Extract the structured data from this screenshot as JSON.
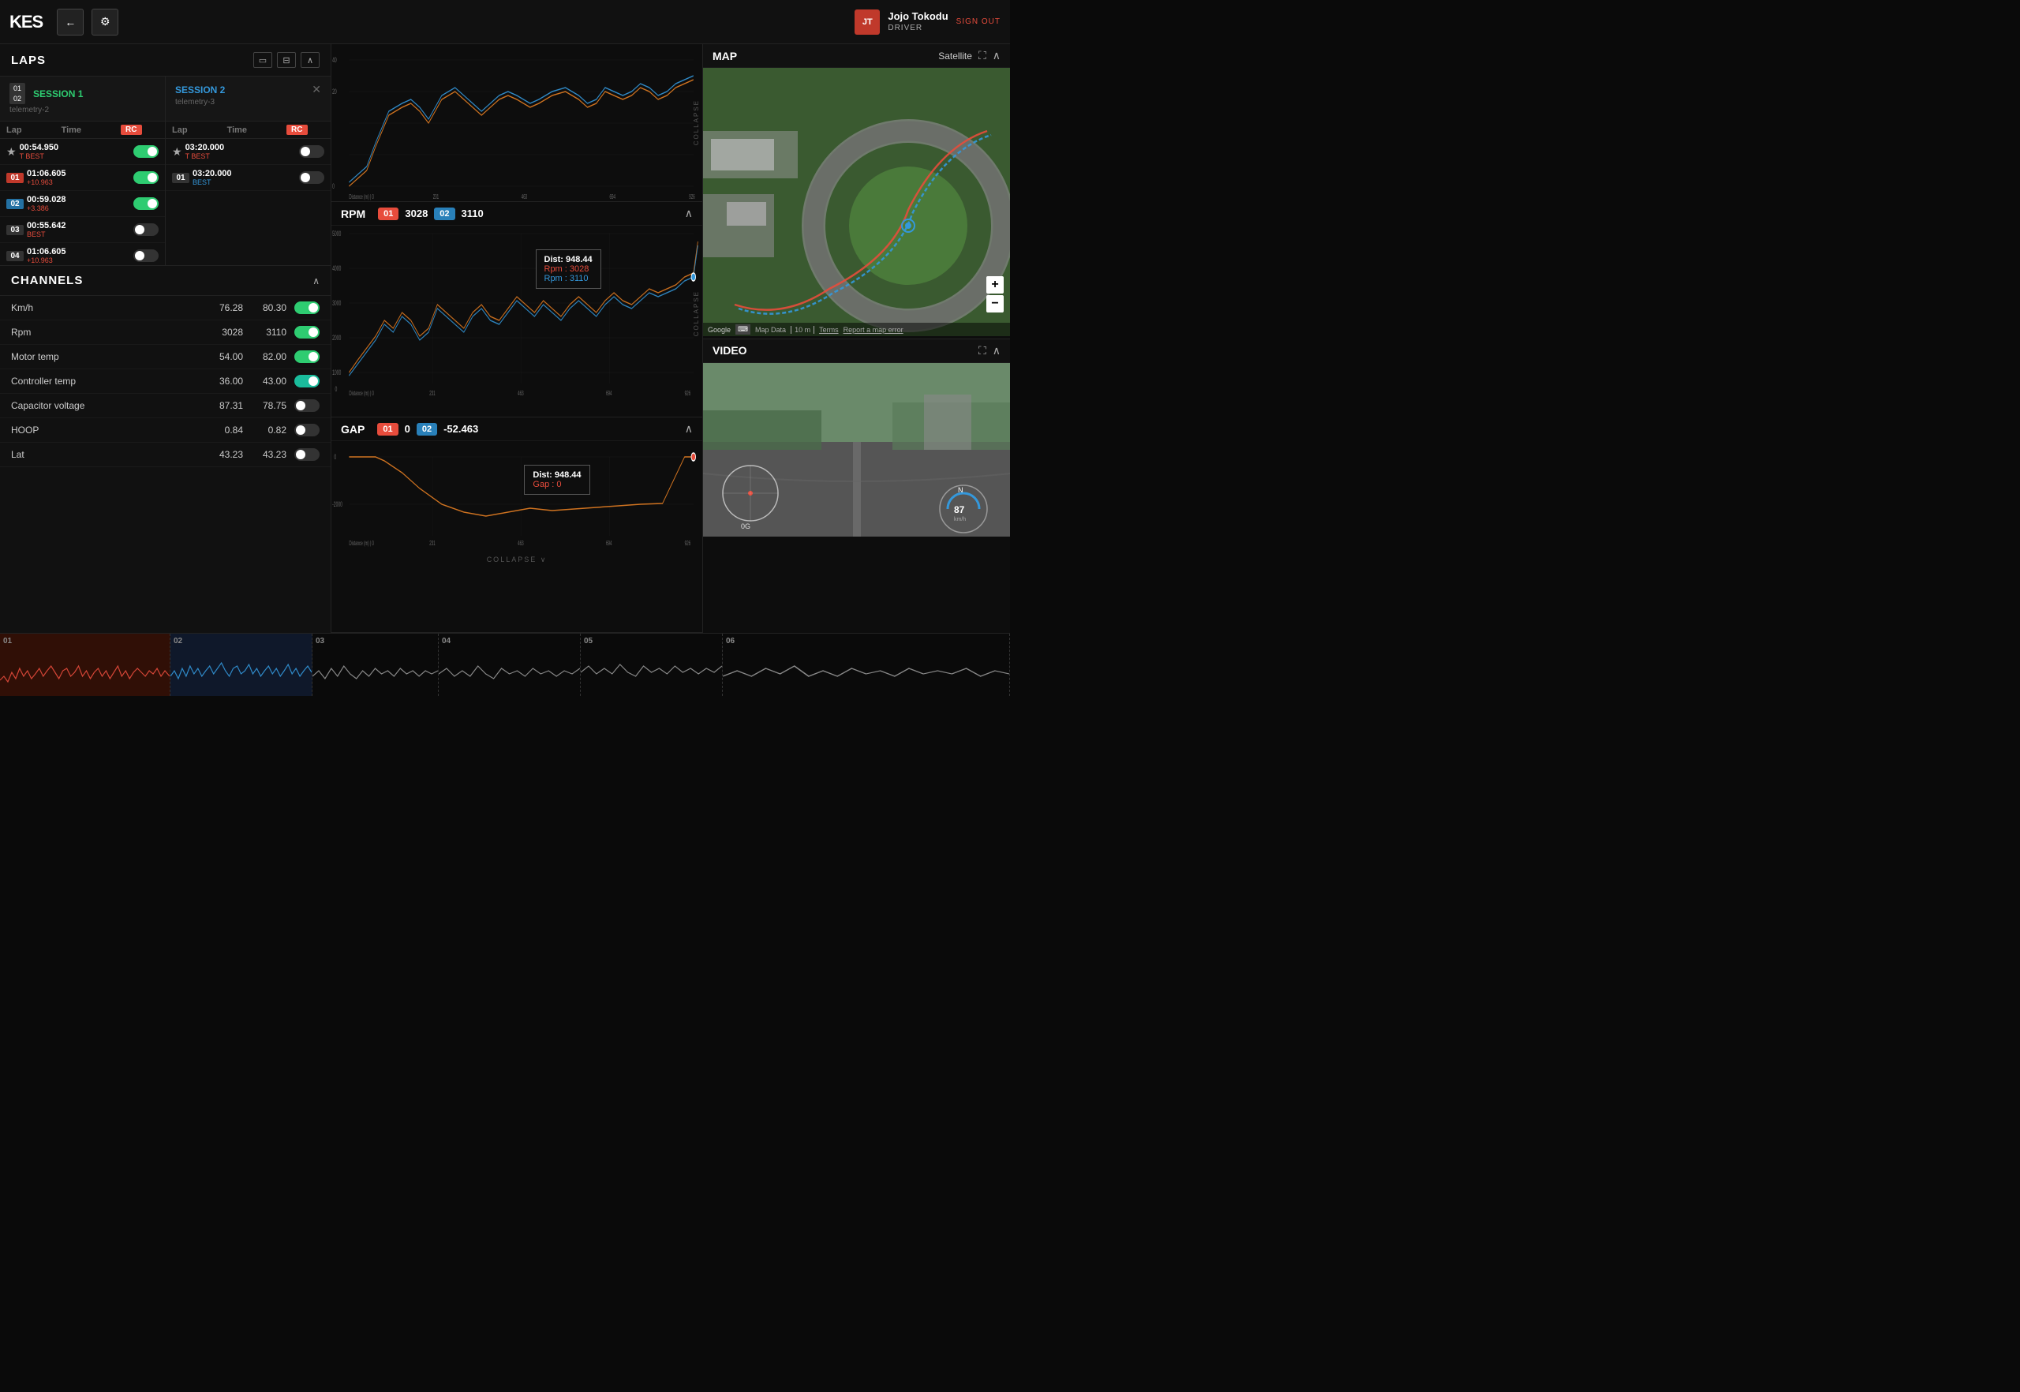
{
  "header": {
    "logo": "KES",
    "back_btn": "←",
    "settings_btn": "⚙",
    "user_initials": "JT",
    "user_name": "Jojo Tokodu",
    "user_role": "DRIVER",
    "sign_out": "SIGN OUT"
  },
  "laps": {
    "title": "LAPS",
    "sessions": [
      {
        "nums": "01\n02",
        "name": "SESSION 1",
        "sub": "telemetry-2",
        "color": "green"
      },
      {
        "name": "SESSION 2",
        "sub": "telemetry-3",
        "color": "blue",
        "has_close": true
      }
    ],
    "col_lap1": "Lap",
    "col_time1": "Time",
    "rc1": "RC",
    "col_lap2": "Lap",
    "col_time2": "Time",
    "rc2": "RC",
    "session1_laps": [
      {
        "num": "★",
        "is_star": true,
        "time": "00:54.950",
        "delta": "T BEST",
        "delta_class": "best",
        "toggle": "on"
      },
      {
        "num": "01",
        "is_star": false,
        "time": "01:06.605",
        "delta": "+10.963",
        "delta_class": "red",
        "toggle": "on",
        "badge_class": "red"
      },
      {
        "num": "02",
        "is_star": false,
        "time": "00:59.028",
        "delta": "+3.386",
        "delta_class": "red",
        "toggle": "on",
        "badge_class": "blue-bg"
      },
      {
        "num": "03",
        "is_star": false,
        "time": "00:55.642",
        "delta": "BEST",
        "delta_class": "best",
        "toggle": "off"
      },
      {
        "num": "04",
        "is_star": false,
        "time": "01:06.605",
        "delta": "+10.963",
        "delta_class": "red",
        "toggle": "off"
      }
    ],
    "session2_laps": [
      {
        "num": "★",
        "is_star": true,
        "time": "03:20.000",
        "delta": "T BEST",
        "delta_class": "best",
        "toggle": "off"
      },
      {
        "num": "01",
        "is_star": false,
        "time": "03:20.000",
        "delta": "BEST",
        "delta_class": "blue-c",
        "toggle": "off"
      }
    ]
  },
  "channels": {
    "title": "CHANNELS",
    "items": [
      {
        "name": "Km/h",
        "val1": "76.28",
        "val2": "80.30",
        "toggle": "on"
      },
      {
        "name": "Rpm",
        "val1": "3028",
        "val2": "3110",
        "toggle": "on"
      },
      {
        "name": "Motor temp",
        "val1": "54.00",
        "val2": "82.00",
        "toggle": "on"
      },
      {
        "name": "Controller temp",
        "val1": "36.00",
        "val2": "43.00",
        "toggle": "active-blue"
      },
      {
        "name": "Capacitor voltage",
        "val1": "87.31",
        "val2": "78.75",
        "toggle": "off"
      },
      {
        "name": "HOOP",
        "val1": "0.84",
        "val2": "0.82",
        "toggle": "off"
      },
      {
        "name": "Lat",
        "val1": "43.23",
        "val2": "43.23",
        "toggle": "off"
      }
    ]
  },
  "rpm_chart": {
    "title": "RPM",
    "badge1": "01",
    "val1": "3028",
    "badge2": "02",
    "val2": "3110",
    "y_labels": [
      "5000",
      "4000",
      "3000",
      "2000",
      "1000",
      "0"
    ],
    "x_labels": [
      "Distance (m) | 0",
      "231",
      "463",
      "694",
      "926"
    ],
    "tooltip": {
      "dist": "Dist: 948.44",
      "val1_label": "Rpm : 3028",
      "val2_label": "Rpm : 3110"
    },
    "collapse_label": "COLLAPSE"
  },
  "gap_chart": {
    "title": "GAP",
    "badge1": "01",
    "val1": "0",
    "badge2": "02",
    "val2": "-52.463",
    "y_labels": [
      "0",
      "-2000"
    ],
    "x_labels": [
      "Distance (m) | 0",
      "231",
      "463",
      "694",
      "926"
    ],
    "tooltip": {
      "dist": "Dist: 948.44",
      "val_label": "Gap : 0"
    },
    "collapse_label": "COLLAPSE"
  },
  "map": {
    "title": "MAP",
    "satellite_btn": "Satellite",
    "zoom_in": "+",
    "zoom_out": "−",
    "google_label": "Google",
    "map_data_label": "Map Data",
    "scale_label": "10 m",
    "terms_label": "Terms",
    "report_label": "Report a map error"
  },
  "video": {
    "title": "VIDEO",
    "speed_display": "87",
    "speed_unit": "km/h",
    "g_display": "0G"
  },
  "timeline": {
    "segments": [
      {
        "label": "01",
        "type": "red"
      },
      {
        "label": "02",
        "type": "blue"
      },
      {
        "label": "03",
        "type": "normal"
      },
      {
        "label": "04",
        "type": "normal"
      },
      {
        "label": "05",
        "type": "normal"
      },
      {
        "label": "06",
        "type": "normal"
      }
    ]
  }
}
